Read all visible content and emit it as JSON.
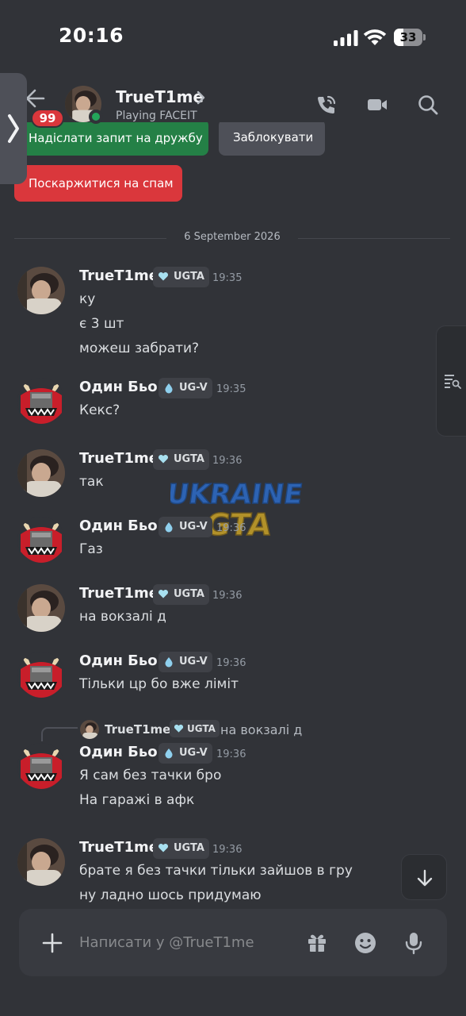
{
  "status_bar": {
    "time": "20:16",
    "battery": "33"
  },
  "header": {
    "unread_badge": "99",
    "name": "TrueT1me",
    "subtitle": "Playing FACEIT",
    "icons": [
      "call-icon",
      "video-icon",
      "search-icon"
    ]
  },
  "actions": {
    "send_friend_request": "Надіслати запит на дружбу",
    "block": "Заблокувати",
    "report_spam": "Поскаржитися на спам"
  },
  "date_separator": "6 September 2026",
  "messages": [
    {
      "author": "TrueT1me",
      "tag": "UGTA",
      "time": "19:35",
      "lines": [
        "ку",
        "є 3 шт",
        "можеш забрати?"
      ]
    },
    {
      "author": "Один Бьор",
      "tag": "UG-V",
      "time": "19:35",
      "lines": [
        "Кекс?"
      ]
    },
    {
      "author": "TrueT1me",
      "tag": "UGTA",
      "time": "19:36",
      "lines": [
        "так"
      ]
    },
    {
      "author": "Один Бьор",
      "tag": "UG-V",
      "time": "19:36",
      "lines": [
        "Газ"
      ]
    },
    {
      "author": "TrueT1me",
      "tag": "UGTA",
      "time": "19:36",
      "lines": [
        "на вокзалі д"
      ]
    },
    {
      "author": "Один Бьор",
      "tag": "UG-V",
      "time": "19:36",
      "lines": [
        "Тільки цр бо вже ліміт"
      ]
    },
    {
      "author": "Один Бьор",
      "tag": "UG-V",
      "time": "19:36",
      "lines": [
        "Я сам без тачки бро",
        "На гаражі в афк"
      ],
      "reply": {
        "author": "TrueT1me",
        "tag": "UGTA",
        "text": "на вокзалі д"
      }
    },
    {
      "author": "TrueT1me",
      "tag": "UGTA",
      "time": "19:36",
      "lines": [
        "брате я без тачки  тільки зайшов в гру",
        "ну ладно шось придумаю"
      ]
    }
  ],
  "composer": {
    "placeholder": "Написати у @TrueT1me"
  },
  "watermark": {
    "line1": "UKRAINE",
    "line2": "GTA"
  },
  "colors": {
    "background": "#313338",
    "green": "#248046",
    "red": "#da373c",
    "online": "#23a55a"
  }
}
